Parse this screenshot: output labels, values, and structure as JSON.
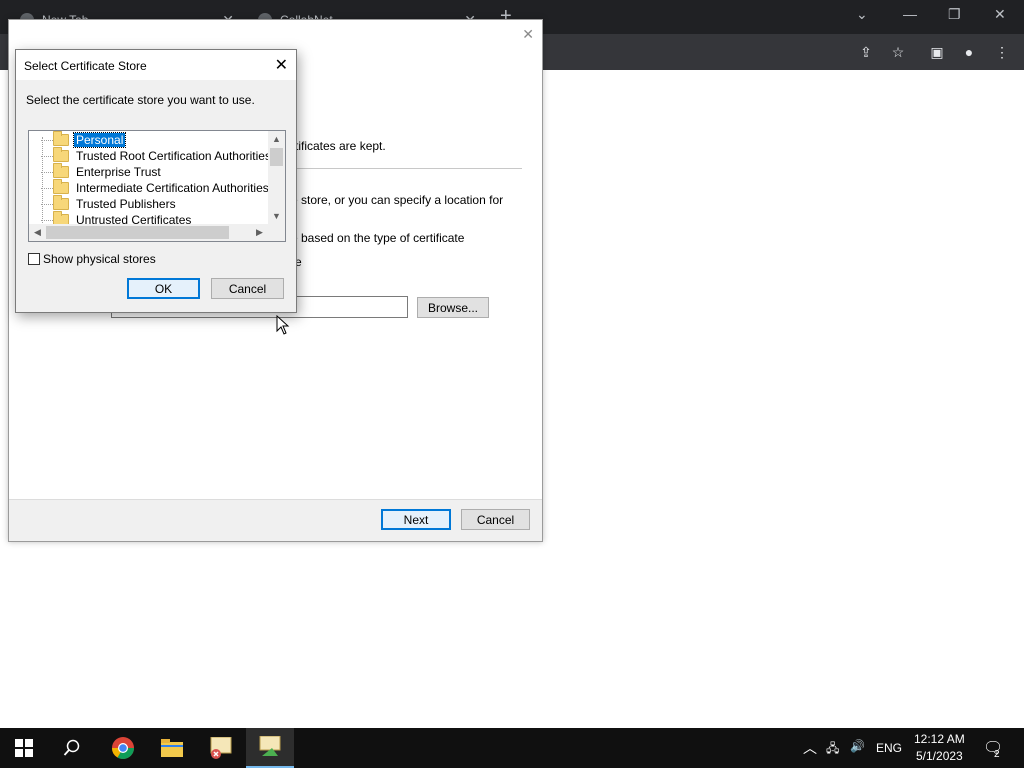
{
  "browser": {
    "tabs": [
      {
        "title": "New Tab"
      },
      {
        "title": "CollabNet"
      }
    ]
  },
  "wizard": {
    "text_cert_kept": "rtificates are kept.",
    "text_store_location": "e store, or you can specify a location for",
    "text_auto_select": "e based on the type of certificate",
    "text_place_all": "re",
    "browse_label": "Browse...",
    "next_label": "Next",
    "cancel_label": "Cancel"
  },
  "dialog": {
    "title": "Select Certificate Store",
    "prompt": "Select the certificate store you want to use.",
    "stores": [
      {
        "label": "Personal",
        "selected": true
      },
      {
        "label": "Trusted Root Certification Authorities",
        "selected": false
      },
      {
        "label": "Enterprise Trust",
        "selected": false
      },
      {
        "label": "Intermediate Certification Authorities",
        "selected": false
      },
      {
        "label": "Trusted Publishers",
        "selected": false
      },
      {
        "label": "Untrusted Certificates",
        "selected": false
      }
    ],
    "show_physical_label": "Show physical stores",
    "show_physical_checked": false,
    "ok_label": "OK",
    "cancel_label": "Cancel"
  },
  "taskbar": {
    "language": "ENG",
    "time": "12:12 AM",
    "date": "5/1/2023",
    "notification_count": "2"
  },
  "colors": {
    "accent": "#0078d7",
    "taskbar": "#101010",
    "chrome_dark": "#202124"
  }
}
